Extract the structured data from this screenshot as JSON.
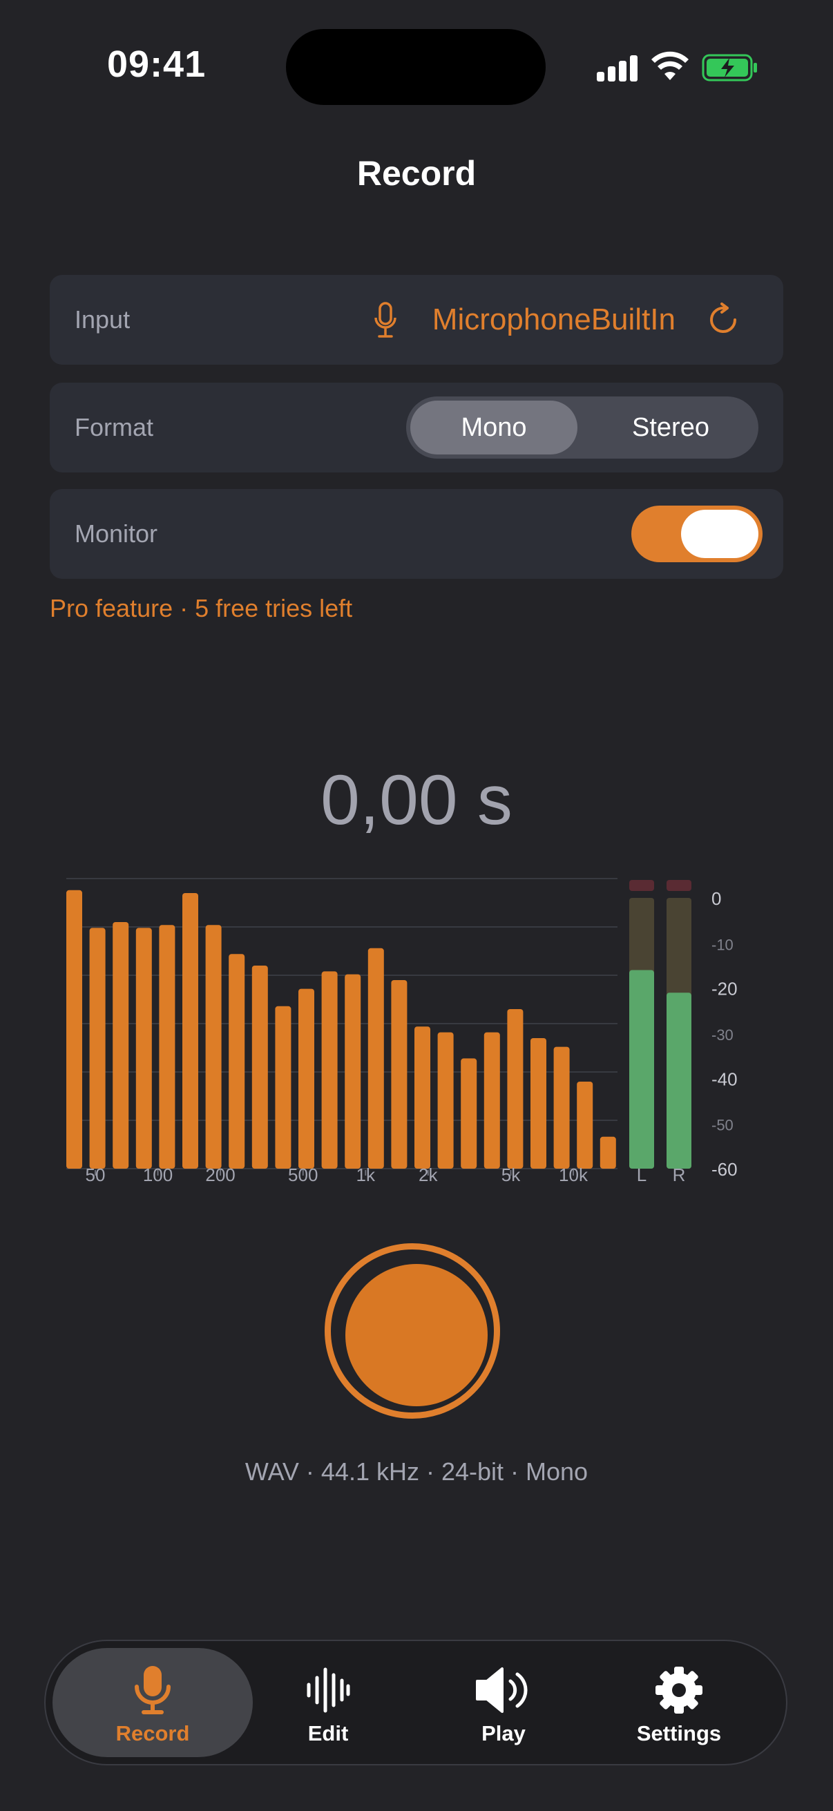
{
  "status_bar": {
    "time": "09:41",
    "battery_color": "#34c759"
  },
  "header": {
    "title": "Record"
  },
  "input_row": {
    "label": "Input",
    "value": "MicrophoneBuiltIn",
    "icon": "mic-icon",
    "action_icon": "refresh-icon"
  },
  "format_row": {
    "label": "Format",
    "options": [
      "Mono",
      "Stereo"
    ],
    "selected": "Mono"
  },
  "monitor_row": {
    "label": "Monitor",
    "enabled": true
  },
  "pro_note": "Pro feature · 5 free tries left",
  "timer": "0,00 s",
  "spectrum": {
    "bar_levels_db": [
      -4,
      -17,
      -15,
      -17,
      -16,
      -5,
      -16,
      -26,
      -30,
      -44,
      -38,
      -32,
      -33,
      -24,
      -35,
      -51,
      -53,
      -62,
      -53,
      -45,
      -55,
      -58,
      -70,
      -89
    ],
    "freq_labels": [
      "50",
      "100",
      "200",
      "500",
      "1k",
      "2k",
      "5k",
      "10k"
    ],
    "meter_channels": [
      "L",
      "R"
    ],
    "meter_levels_db": [
      -16,
      -21
    ],
    "db_scale": [
      "0",
      "-10",
      "-20",
      "-30",
      "-40",
      "-50",
      "-60"
    ],
    "bar_color": "#dd7d27",
    "meter_color": "#5aa76a"
  },
  "record_button": {
    "accent": "#e07f2d"
  },
  "format_info": "WAV · 44.1 kHz · 24-bit · Mono",
  "tabbar": {
    "tabs": [
      {
        "label": "Record",
        "icon": "mic-icon",
        "active": true
      },
      {
        "label": "Edit",
        "icon": "waveform-icon",
        "active": false
      },
      {
        "label": "Play",
        "icon": "speaker-icon",
        "active": false
      },
      {
        "label": "Settings",
        "icon": "gear-icon",
        "active": false
      }
    ]
  },
  "colors": {
    "background": "#232327",
    "accent": "#e07f2d",
    "row_bg": "#2c2e36"
  }
}
